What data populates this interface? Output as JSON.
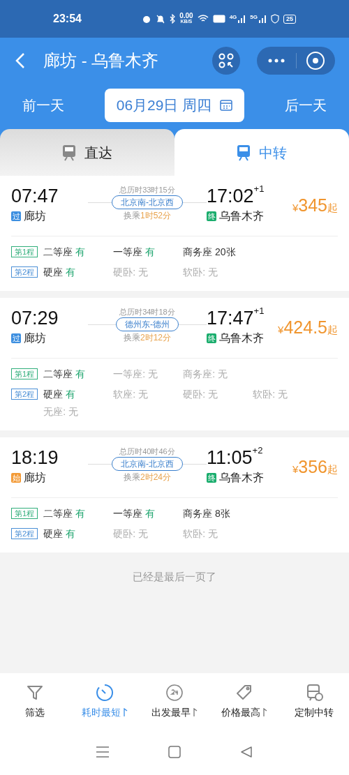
{
  "status_bar": {
    "time": "23:54",
    "speed": "0.00",
    "speed_unit": "KB/S",
    "signals": [
      "4G",
      "5G"
    ],
    "battery": "25"
  },
  "header": {
    "title": "廊坊 - 乌鲁木齐",
    "prev_day": "前一天",
    "date": "06月29日 周四",
    "next_day": "后一天"
  },
  "tabs": [
    {
      "label": "直达",
      "selected": false
    },
    {
      "label": "中转",
      "selected": true
    }
  ],
  "trains": [
    {
      "depart_time": "07:47",
      "depart_badge": {
        "text": "过",
        "color": "#3d8fe0"
      },
      "depart_station": "廊坊",
      "total": "总历时33时15分",
      "transfer_stations": "北京南-北京西",
      "transfer_label": "换乘",
      "transfer_time": "1时52分",
      "arrive_time": "17:02",
      "day_offset": "+1",
      "arrive_badge": {
        "text": "终",
        "color": "#1aad6d"
      },
      "arrive_station": "乌鲁木齐",
      "currency": "¥",
      "price": "345",
      "price_suffix": "起",
      "legs": [
        {
          "label": "第1程",
          "color": "#2fae7a",
          "seats": [
            {
              "kind": "yes",
              "name": "二等座",
              "status": "有"
            },
            {
              "kind": "yes",
              "name": "一等座",
              "status": "有"
            },
            {
              "kind": "count",
              "name": "商务座",
              "status": "20张"
            }
          ]
        },
        {
          "label": "第2程",
          "color": "#4a8fd6",
          "seats": [
            {
              "kind": "yes",
              "name": "硬座",
              "status": "有"
            },
            {
              "kind": "none",
              "name": "硬卧:",
              "status": "无"
            },
            {
              "kind": "none",
              "name": "软卧:",
              "status": "无"
            }
          ]
        }
      ]
    },
    {
      "depart_time": "07:29",
      "depart_badge": {
        "text": "过",
        "color": "#3d8fe0"
      },
      "depart_station": "廊坊",
      "total": "总历时34时18分",
      "transfer_stations": "德州东-德州",
      "transfer_label": "换乘",
      "transfer_time": "2时12分",
      "arrive_time": "17:47",
      "day_offset": "+1",
      "arrive_badge": {
        "text": "终",
        "color": "#1aad6d"
      },
      "arrive_station": "乌鲁木齐",
      "currency": "¥",
      "price": "424.5",
      "price_suffix": "起",
      "legs": [
        {
          "label": "第1程",
          "color": "#2fae7a",
          "seats": [
            {
              "kind": "yes",
              "name": "二等座",
              "status": "有"
            },
            {
              "kind": "none",
              "name": "一等座:",
              "status": "无"
            },
            {
              "kind": "none",
              "name": "商务座:",
              "status": "无"
            }
          ]
        },
        {
          "label": "第2程",
          "color": "#4a8fd6",
          "seats": [
            {
              "kind": "yes",
              "name": "硬座",
              "status": "有"
            },
            {
              "kind": "none",
              "name": "软座:",
              "status": "无"
            },
            {
              "kind": "none",
              "name": "硬卧:",
              "status": "无"
            },
            {
              "kind": "none",
              "name": "软卧:",
              "status": "无"
            },
            {
              "kind": "none",
              "name": "无座:",
              "status": "无"
            }
          ]
        }
      ]
    },
    {
      "depart_time": "18:19",
      "depart_badge": {
        "text": "始",
        "color": "#f39a36"
      },
      "depart_station": "廊坊",
      "total": "总历时40时46分",
      "transfer_stations": "北京南-北京西",
      "transfer_label": "换乘",
      "transfer_time": "2时24分",
      "arrive_time": "11:05",
      "day_offset": "+2",
      "arrive_badge": {
        "text": "终",
        "color": "#1aad6d"
      },
      "arrive_station": "乌鲁木齐",
      "currency": "¥",
      "price": "356",
      "price_suffix": "起",
      "legs": [
        {
          "label": "第1程",
          "color": "#2fae7a",
          "seats": [
            {
              "kind": "yes",
              "name": "二等座",
              "status": "有"
            },
            {
              "kind": "yes",
              "name": "一等座",
              "status": "有"
            },
            {
              "kind": "count",
              "name": "商务座",
              "status": "8张"
            }
          ]
        },
        {
          "label": "第2程",
          "color": "#4a8fd6",
          "seats": [
            {
              "kind": "yes",
              "name": "硬座",
              "status": "有"
            },
            {
              "kind": "none",
              "name": "硬卧:",
              "status": "无"
            },
            {
              "kind": "none",
              "name": "软卧:",
              "status": "无"
            }
          ]
        }
      ]
    }
  ],
  "end_note": "已经是最后一页了",
  "bottom_bar": [
    {
      "kind": "filter",
      "label": "筛选",
      "sortable": false,
      "selected": false
    },
    {
      "kind": "duration",
      "label": "耗时最短",
      "sortable": true,
      "selected": true
    },
    {
      "kind": "earliest",
      "label": "出发最早",
      "sortable": true,
      "selected": false
    },
    {
      "kind": "price",
      "label": "价格最高",
      "sortable": true,
      "selected": false
    },
    {
      "kind": "custom",
      "label": "定制中转",
      "sortable": false,
      "selected": false
    }
  ]
}
